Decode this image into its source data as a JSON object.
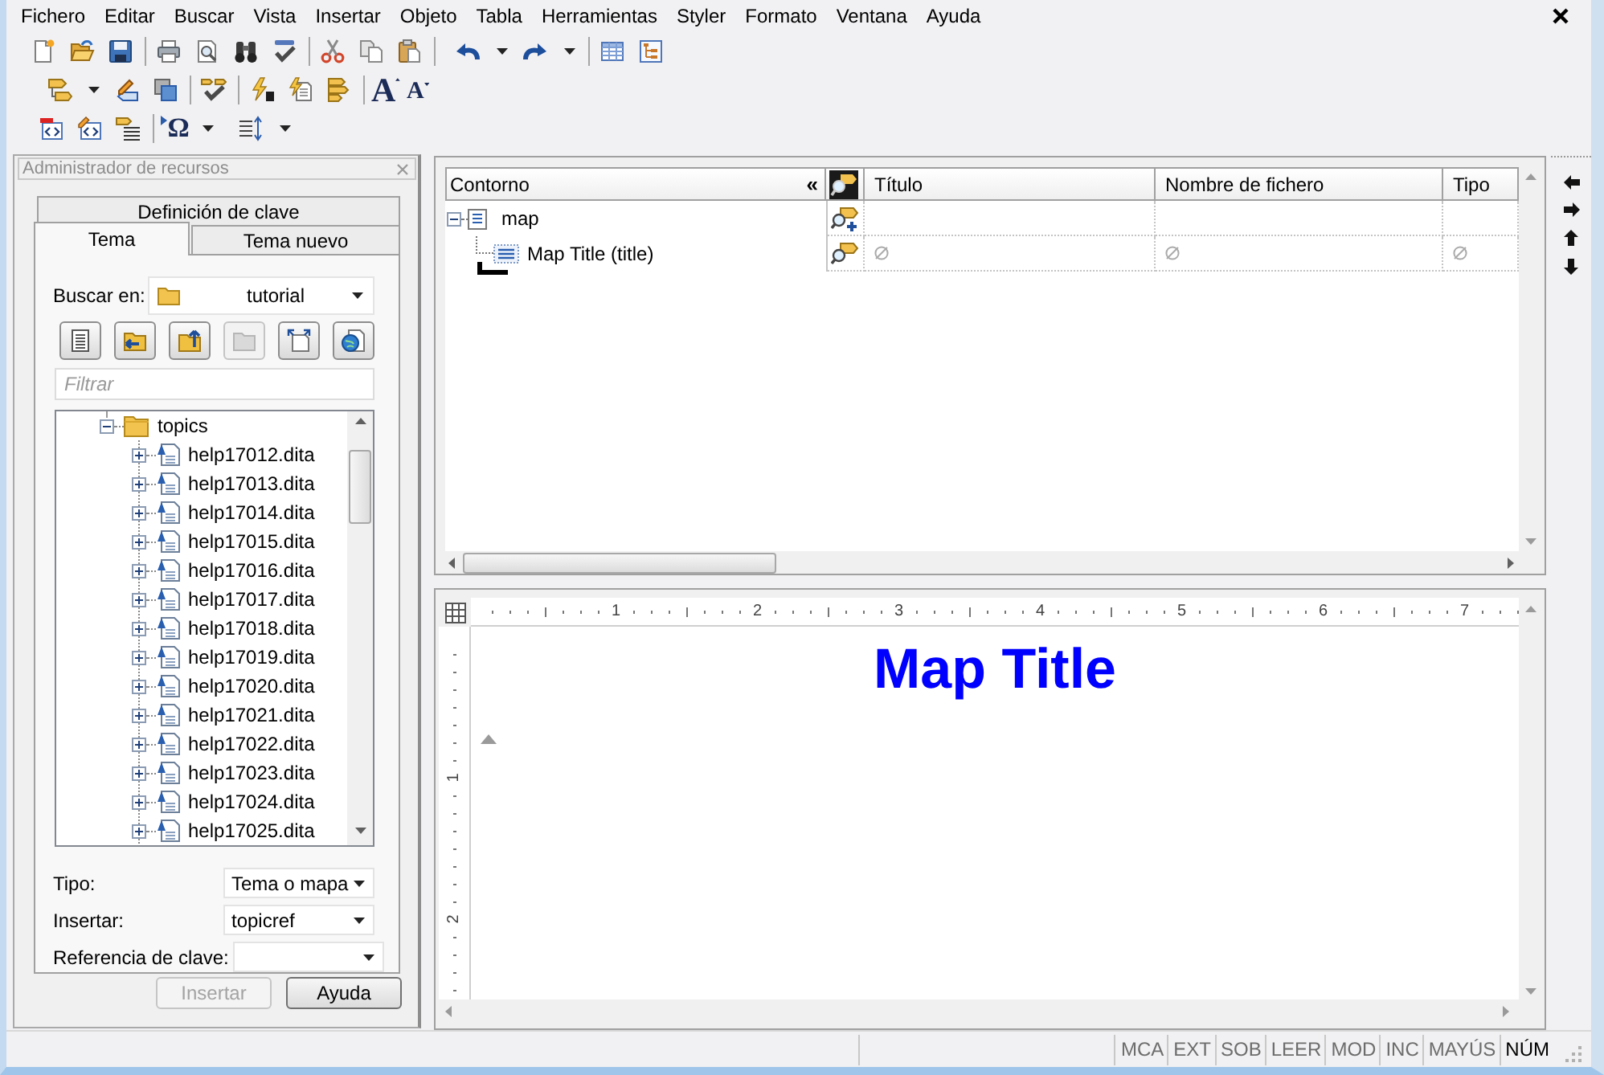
{
  "menu_bar": [
    "Fichero",
    "Editar",
    "Buscar",
    "Vista",
    "Insertar",
    "Objeto",
    "Tabla",
    "Herramientas",
    "Styler",
    "Formato",
    "Ventana",
    "Ayuda"
  ],
  "toolbar_glyphs": [
    {
      "kind": "font-grow",
      "text": "A"
    },
    {
      "kind": "font-shrink",
      "text": "A"
    },
    {
      "kind": "symbol",
      "text": "Ω"
    }
  ],
  "resource_manager": {
    "title": "Administrador de recursos",
    "tabs": [
      {
        "label": "Definición de clave",
        "selected": false
      },
      {
        "label": "Tema",
        "selected": true
      },
      {
        "label": "Tema nuevo",
        "selected": false
      }
    ],
    "search_in": {
      "label": "Buscar en:",
      "value": "tutorial"
    },
    "buttons": [
      {
        "disabled": false
      },
      {
        "disabled": false
      },
      {
        "disabled": false
      },
      {
        "disabled": true
      },
      {
        "disabled": false
      },
      {
        "disabled": false
      }
    ],
    "filter": {
      "placeholder": "Filtrar"
    },
    "tree": [
      {
        "label": "topics",
        "expanded": true,
        "children": [
          {
            "label": "help17012.dita",
            "expanded": false
          },
          {
            "label": "help17013.dita",
            "expanded": false
          },
          {
            "label": "help17014.dita",
            "expanded": false
          },
          {
            "label": "help17015.dita",
            "expanded": false
          },
          {
            "label": "help17016.dita",
            "expanded": false
          },
          {
            "label": "help17017.dita",
            "expanded": false
          },
          {
            "label": "help17018.dita",
            "expanded": false
          },
          {
            "label": "help17019.dita",
            "expanded": false
          },
          {
            "label": "help17020.dita",
            "expanded": false
          },
          {
            "label": "help17021.dita",
            "expanded": false
          },
          {
            "label": "help17022.dita",
            "expanded": false
          },
          {
            "label": "help17023.dita",
            "expanded": false
          },
          {
            "label": "help17024.dita",
            "expanded": false
          },
          {
            "label": "help17025.dita",
            "expanded": false
          }
        ]
      }
    ],
    "fields": [
      {
        "label": "Tipo:",
        "value": "Tema o mapa"
      },
      {
        "label": "Insertar:",
        "value": "topicref"
      },
      {
        "label": "Referencia de clave:"
      }
    ],
    "actions": [
      {
        "label": "Insertar",
        "disabled": true
      },
      {
        "label": "Ayuda",
        "disabled": false
      }
    ]
  },
  "outline": {
    "columns": [
      "Contorno",
      "Título",
      "Nombre de fichero",
      "Tipo"
    ],
    "collapse_glyph": "«",
    "rows": [
      {
        "label": "map",
        "kind": "map",
        "expanded": true,
        "cells": [
          {
            "empty_marker": false
          },
          {
            "empty_marker": false
          },
          {
            "empty_marker": false
          }
        ],
        "children": [
          {
            "label": "Map Title (title)",
            "kind": "title",
            "cells": [
              {
                "empty_marker": true
              },
              {
                "empty_marker": true
              },
              {
                "empty_marker": true
              }
            ]
          }
        ]
      }
    ]
  },
  "editor": {
    "ruler_labels": [
      "1",
      "2",
      "3",
      "4",
      "5",
      "6",
      "7"
    ],
    "side_ruler_labels": [
      "1",
      "2"
    ],
    "heading": "Map Title"
  },
  "status_bar": {
    "indicators": [
      {
        "label": "MCA",
        "on": false
      },
      {
        "label": "EXT",
        "on": false
      },
      {
        "label": "SOB",
        "on": false
      },
      {
        "label": "LEER",
        "on": false
      },
      {
        "label": "MOD",
        "on": false
      },
      {
        "label": "INC",
        "on": false
      },
      {
        "label": "MAYÚS",
        "on": false
      },
      {
        "label": "NÚM",
        "on": true
      }
    ]
  }
}
